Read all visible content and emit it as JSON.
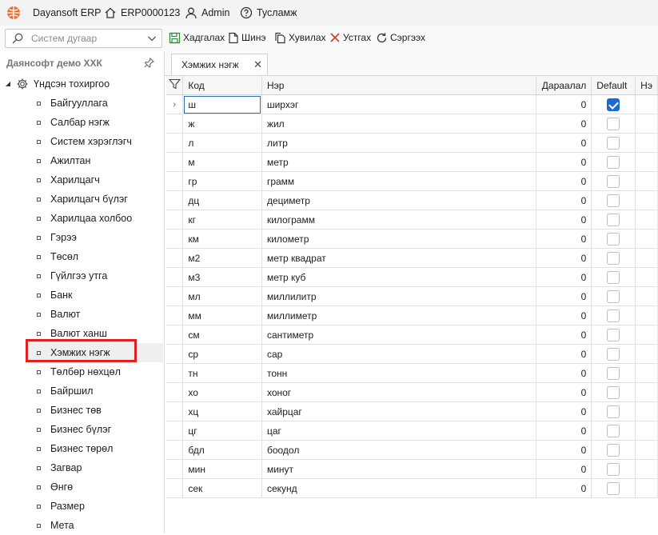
{
  "titlebar": {
    "app_name": "Dayansoft ERP",
    "record_id": "ERP0000123",
    "user": "Admin",
    "help": "Тусламж"
  },
  "search": {
    "placeholder": "Систем дугаар"
  },
  "toolbar": {
    "save": "Хадгалах",
    "new": "Шинэ",
    "copy": "Хувилах",
    "delete": "Устгах",
    "refresh": "Сэргээх"
  },
  "sidebar": {
    "company": "Даянсофт демо ХХК",
    "root": "Үндсэн тохиргоо",
    "items": [
      "Байгууллага",
      "Салбар нэгж",
      "Систем хэрэглэгч",
      "Ажилтан",
      "Харилцагч",
      "Харилцагч бүлэг",
      "Харилцаа холбоо",
      "Гэрээ",
      "Төсөл",
      "Гүйлгээ утга",
      "Банк",
      "Валют",
      "Валют ханш",
      "Хэмжих нэгж",
      "Төлбөр нөхцөл",
      "Байршил",
      "Бизнес төв",
      "Бизнес бүлэг",
      "Бизнес төрөл",
      "Загвар",
      "Өнгө",
      "Размер",
      "Мета"
    ],
    "active_index": 13
  },
  "tab": {
    "label": "Хэмжих нэгж"
  },
  "grid": {
    "columns": [
      "Код",
      "Нэр",
      "Дараалал",
      "Default",
      "Нэ"
    ],
    "rows": [
      {
        "code": "ш",
        "name": "ширхэг",
        "order": "0",
        "default": true
      },
      {
        "code": "ж",
        "name": "жил",
        "order": "0",
        "default": false
      },
      {
        "code": "л",
        "name": "литр",
        "order": "0",
        "default": false
      },
      {
        "code": "м",
        "name": "метр",
        "order": "0",
        "default": false
      },
      {
        "code": "гр",
        "name": "грамм",
        "order": "0",
        "default": false
      },
      {
        "code": "дц",
        "name": "дециметр",
        "order": "0",
        "default": false
      },
      {
        "code": "кг",
        "name": "килограмм",
        "order": "0",
        "default": false
      },
      {
        "code": "км",
        "name": "километр",
        "order": "0",
        "default": false
      },
      {
        "code": "м2",
        "name": "метр квадрат",
        "order": "0",
        "default": false
      },
      {
        "code": "м3",
        "name": "метр куб",
        "order": "0",
        "default": false
      },
      {
        "code": "мл",
        "name": "миллилитр",
        "order": "0",
        "default": false
      },
      {
        "code": "мм",
        "name": "миллиметр",
        "order": "0",
        "default": false
      },
      {
        "code": "см",
        "name": "сантиметр",
        "order": "0",
        "default": false
      },
      {
        "code": "ср",
        "name": "сар",
        "order": "0",
        "default": false
      },
      {
        "code": "тн",
        "name": "тонн",
        "order": "0",
        "default": false
      },
      {
        "code": "хо",
        "name": "хоног",
        "order": "0",
        "default": false
      },
      {
        "code": "хц",
        "name": "хайрцаг",
        "order": "0",
        "default": false
      },
      {
        "code": "цг",
        "name": "цаг",
        "order": "0",
        "default": false
      },
      {
        "code": "бдл",
        "name": "боодол",
        "order": "0",
        "default": false
      },
      {
        "code": "мин",
        "name": "минут",
        "order": "0",
        "default": false
      },
      {
        "code": "сек",
        "name": "секунд",
        "order": "0",
        "default": false
      }
    ]
  },
  "colors": {
    "accent": "#1a6bd0",
    "highlight": "#e02020",
    "logo": "#e8713a"
  }
}
